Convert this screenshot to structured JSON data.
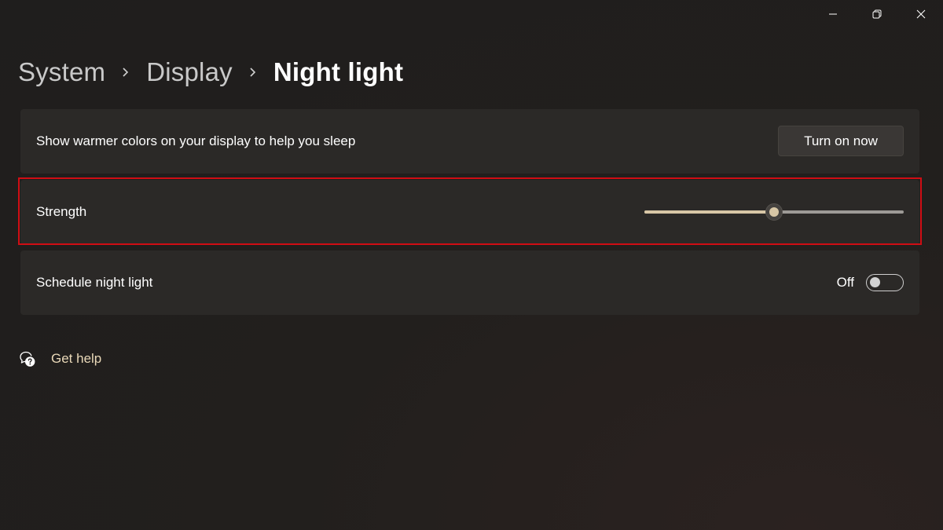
{
  "window_controls": {
    "minimize": "minimize-icon",
    "restore": "restore-icon",
    "close": "close-icon"
  },
  "breadcrumb": {
    "items": [
      "System",
      "Display"
    ],
    "current": "Night light",
    "separator_icon": "chevron-right-icon"
  },
  "cards": {
    "warm": {
      "label": "Show warmer colors on your display to help you sleep",
      "button_label": "Turn on now"
    },
    "strength": {
      "label": "Strength",
      "value_percent": 50
    },
    "schedule": {
      "label": "Schedule night light",
      "state_label": "Off",
      "enabled": false
    }
  },
  "help": {
    "label": "Get help",
    "icon": "help-chat-icon"
  },
  "colors": {
    "accent": "#d8c7a6",
    "highlight_border": "#d00d14",
    "card_background": "#2b2927",
    "link_text": "#e9d8b8"
  }
}
